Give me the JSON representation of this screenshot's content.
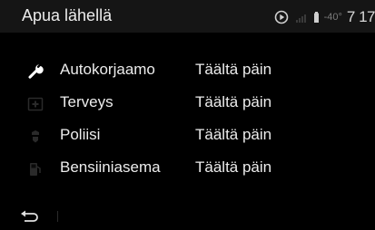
{
  "header": {
    "title": "Apua lähellä",
    "outside_temp": "-40°",
    "clock": "7 17",
    "icons": {
      "media": "play-circle-icon",
      "signal": "signal-bars-icon",
      "battery": "phone-battery-icon"
    }
  },
  "items": [
    {
      "name": "Autokorjaamo",
      "direction": "Täältä päin",
      "icon": "wrench-icon",
      "icon_color": "#ffffff"
    },
    {
      "name": "Terveys",
      "direction": "Täältä päin",
      "icon": "first-aid-icon",
      "icon_color": "#2a2a2a"
    },
    {
      "name": "Poliisi",
      "direction": "Täältä päin",
      "icon": "police-icon",
      "icon_color": "#2a2a2a"
    },
    {
      "name": "Bensiiniasema",
      "direction": "Täältä päin",
      "icon": "fuel-pump-icon",
      "icon_color": "#2a2a2a"
    }
  ],
  "footer": {
    "back_icon": "back-arrow-icon"
  },
  "colors": {
    "background": "#000000",
    "header_bg": "#151515",
    "text": "#ececec",
    "muted": "#7a7a7a"
  }
}
